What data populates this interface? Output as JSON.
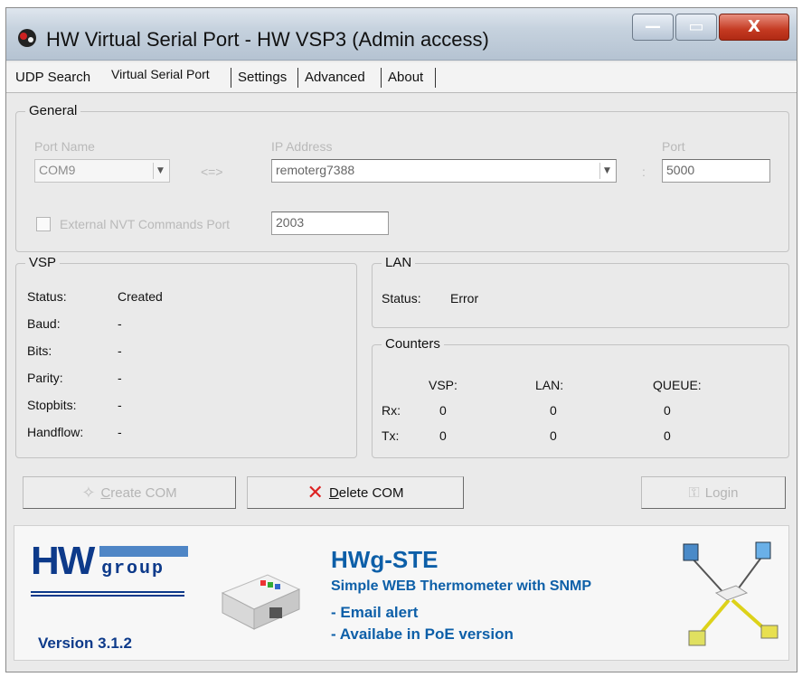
{
  "window": {
    "title": "HW Virtual Serial Port - HW VSP3 (Admin access)",
    "minimize_glyph": "—",
    "maximize_glyph": "▭",
    "close_glyph": "X"
  },
  "tabs": [
    {
      "label": "UDP Search"
    },
    {
      "label": "Virtual Serial Port",
      "active": true
    },
    {
      "label": "Settings"
    },
    {
      "label": "Advanced"
    },
    {
      "label": "About"
    }
  ],
  "general": {
    "legend": "General",
    "port_name_label": "Port Name",
    "port_name_value": "COM9",
    "arrow_text": "<=>",
    "ip_label": "IP Address",
    "ip_value": "remoterg7388",
    "port_label": "Port",
    "colon": ":",
    "port_value": "5000",
    "nvt_label": "External NVT Commands Port",
    "nvt_value": "2003"
  },
  "vsp": {
    "legend": "VSP",
    "rows": [
      {
        "label": "Status:",
        "value": "Created"
      },
      {
        "label": "Baud:",
        "value": "-"
      },
      {
        "label": "Bits:",
        "value": "-"
      },
      {
        "label": "Parity:",
        "value": "-"
      },
      {
        "label": "Stopbits:",
        "value": "-"
      },
      {
        "label": "Handflow:",
        "value": "-"
      }
    ]
  },
  "lan": {
    "legend": "LAN",
    "status_label": "Status:",
    "status_value": "Error"
  },
  "counters": {
    "legend": "Counters",
    "headers": [
      "VSP:",
      "LAN:",
      "QUEUE:"
    ],
    "rx_label": "Rx:",
    "tx_label": "Tx:",
    "rx": [
      "0",
      "0",
      "0"
    ],
    "tx": [
      "0",
      "0",
      "0"
    ]
  },
  "buttons": {
    "create_com": "Create COM",
    "create_com_ul": "C",
    "create_com_rest": "reate COM",
    "delete_com_ul": "D",
    "delete_com_rest": "elete COM",
    "login": "Login"
  },
  "banner": {
    "logo_hw": "HW",
    "logo_group": "group",
    "version": "Version 3.1.2",
    "product": "HWg-STE",
    "subtitle": "Simple WEB Thermometer with SNMP",
    "bullet1": "- Email alert",
    "bullet2": "- Availabe in PoE version"
  },
  "colors": {
    "brand_blue": "#0d3a8a",
    "banner_text": "#0d5fa8",
    "delete_icon": "#dd2222"
  }
}
